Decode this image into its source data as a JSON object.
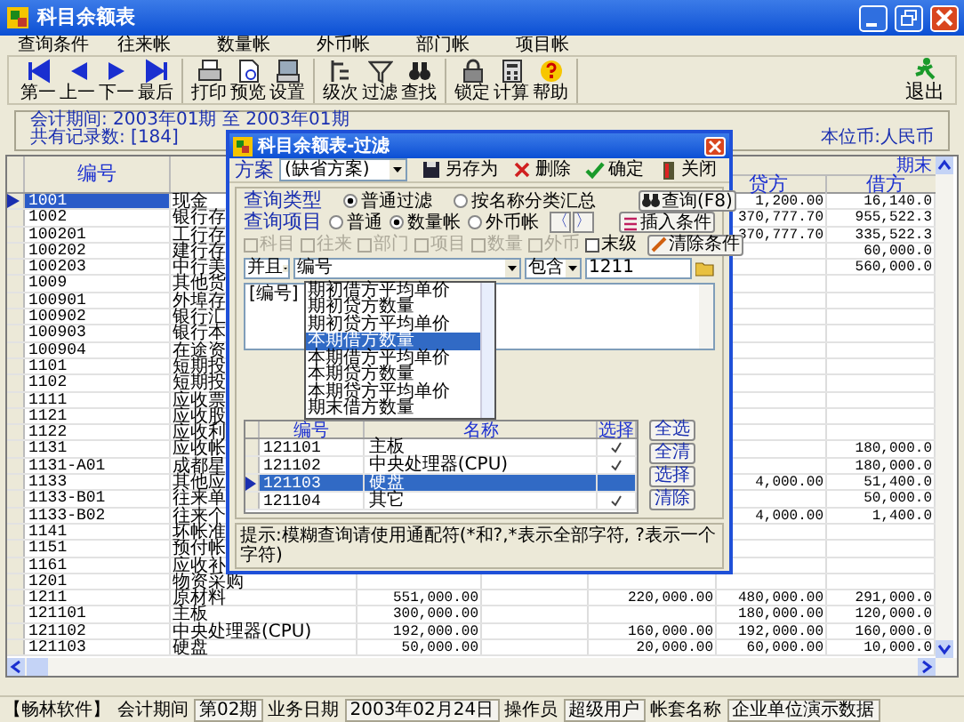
{
  "window": {
    "title": "科目余额表"
  },
  "menu": [
    {
      "label": "查询条件"
    },
    {
      "label": "往来帐"
    },
    {
      "label": "数量帐"
    },
    {
      "label": "外币帐"
    },
    {
      "label": "部门帐"
    },
    {
      "label": "项目帐"
    }
  ],
  "toolbar": {
    "groups": [
      [
        "第一",
        "上一",
        "下一",
        "最后"
      ],
      [
        "打印",
        "预览",
        "设置"
      ],
      [
        "级次",
        "过滤",
        "查找"
      ],
      [
        "锁定",
        "计算",
        "帮助"
      ]
    ],
    "exit": "退出"
  },
  "info": {
    "period": "会计期间: 2003年01期 至 2003年01期",
    "count": "共有记录数: [184]",
    "currency": "本位币:人民币"
  },
  "grid": {
    "header": {
      "code": "编号",
      "group": "期末",
      "credit": "贷方",
      "debit": "借方"
    },
    "rows": [
      {
        "code": "1001",
        "name": "现金",
        "credit": "1,200.00",
        "debit": "16,140.0",
        "selected": true
      },
      {
        "code": "1002",
        "name": "银行存",
        "credit": "370,777.70",
        "debit": "955,522.3",
        "selected": false
      },
      {
        "code": "100201",
        "name": "工行存",
        "credit": "370,777.70",
        "debit": "335,522.3",
        "selected": false
      },
      {
        "code": "100202",
        "name": "建行存",
        "debit": "60,000.0",
        "selected": false
      },
      {
        "code": "100203",
        "name": "中行美",
        "debit": "560,000.0",
        "selected": false
      },
      {
        "code": "1009",
        "name": "其他货",
        "selected": false
      },
      {
        "code": "100901",
        "name": "外埠存",
        "selected": false
      },
      {
        "code": "100902",
        "name": "银行汇",
        "selected": false
      },
      {
        "code": "100903",
        "name": "银行本",
        "selected": false
      },
      {
        "code": "100904",
        "name": "在途资",
        "selected": false
      },
      {
        "code": "1101",
        "name": "短期投",
        "selected": false
      },
      {
        "code": "1102",
        "name": "短期投",
        "selected": false
      },
      {
        "code": "1111",
        "name": "应收票",
        "selected": false
      },
      {
        "code": "1121",
        "name": "应收股",
        "selected": false
      },
      {
        "code": "1122",
        "name": "应收利",
        "selected": false
      },
      {
        "code": "1131",
        "name": "应收帐",
        "debit": "180,000.0",
        "selected": false
      },
      {
        "code": "1131-A01",
        "name": "成都星",
        "debit": "180,000.0",
        "selected": false
      },
      {
        "code": "1133",
        "name": "其他应",
        "credit": "4,000.00",
        "debit": "51,400.0",
        "selected": false
      },
      {
        "code": "1133-B01",
        "name": "往来单",
        "debit": "50,000.0",
        "selected": false
      },
      {
        "code": "1133-B02",
        "name": "往来个",
        "credit": "4,000.00",
        "debit": "1,400.0",
        "selected": false
      },
      {
        "code": "1141",
        "name": "坏帐准",
        "selected": false
      },
      {
        "code": "1151",
        "name": "预付帐",
        "selected": false
      },
      {
        "code": "1161",
        "name": "应收补",
        "selected": false
      },
      {
        "code": "1201",
        "name": "物资采购",
        "selected": false
      },
      {
        "code": "1211",
        "name": "原材料",
        "column_3": "551,000.00",
        "column_5": "220,000.00",
        "credit": "480,000.00",
        "debit": "291,000.0",
        "selected": false
      },
      {
        "code": "121101",
        "name": "主板",
        "column_3": "300,000.00",
        "credit": "180,000.00",
        "debit": "120,000.0",
        "selected": false
      },
      {
        "code": "121102",
        "name": "中央处理器(CPU)",
        "column_3": "192,000.00",
        "column_5": "160,000.00",
        "credit": "192,000.00",
        "debit": "160,000.0",
        "selected": false
      },
      {
        "code": "121103",
        "name": "硬盘",
        "column_3": "50,000.00",
        "column_5": "20,000.00",
        "credit": "60,000.00",
        "debit": "10,000.0",
        "selected": false
      }
    ]
  },
  "dialog": {
    "title": "科目余额表-过滤",
    "scheme_label": "方案",
    "scheme_value": "(缺省方案)",
    "actions": [
      "另存为",
      "删除",
      "确定",
      "关闭"
    ],
    "query_type": {
      "label": "查询类型",
      "options": [
        {
          "label": "普通过滤",
          "selected": true
        },
        {
          "label": "按名称分类汇总",
          "selected": false
        }
      ],
      "button": "查询(F8)"
    },
    "query_item": {
      "label": "查询项目",
      "options": [
        {
          "label": "普通",
          "selected": false
        },
        {
          "label": "数量帐",
          "selected": true
        },
        {
          "label": "外币帐",
          "selected": false
        }
      ],
      "nav": [
        "〈",
        "〉"
      ],
      "insert_button": "插入条件",
      "clear_button": "清除条件"
    },
    "checks": [
      {
        "label": "科目",
        "checked": false,
        "disabled": true
      },
      {
        "label": "往来",
        "checked": false,
        "disabled": true
      },
      {
        "label": "部门",
        "checked": false,
        "disabled": true
      },
      {
        "label": "项目",
        "checked": false,
        "disabled": true
      },
      {
        "label": "数量",
        "checked": false,
        "disabled": true
      },
      {
        "label": "外币",
        "checked": false,
        "disabled": true
      },
      {
        "label": "末级",
        "checked": false,
        "disabled": false
      }
    ],
    "condition": {
      "logic": "并且",
      "field": "编号",
      "operator": "包含",
      "value": "1211"
    },
    "expression": "[编号]",
    "field_list": [
      {
        "label": "期初借方平均单价",
        "selected": false
      },
      {
        "label": "期初贷方数量",
        "selected": false
      },
      {
        "label": "期初贷方平均单价",
        "selected": false
      },
      {
        "label": "本期借方数量",
        "selected": true
      },
      {
        "label": "本期借方平均单价",
        "selected": false
      },
      {
        "label": "本期贷方数量",
        "selected": false
      },
      {
        "label": "本期贷方平均单价",
        "selected": false
      },
      {
        "label": "期末借方数量",
        "selected": false
      }
    ],
    "table": {
      "columns": [
        "编号",
        "名称",
        "选择"
      ],
      "rows": [
        {
          "code": "121101",
          "name": "主板",
          "checked": true,
          "selected": false
        },
        {
          "code": "121102",
          "name": "中央处理器(CPU)",
          "checked": true,
          "selected": false
        },
        {
          "code": "121103",
          "name": "硬盘",
          "checked": false,
          "selected": true
        },
        {
          "code": "121104",
          "name": "其它",
          "checked": true,
          "selected": false
        }
      ]
    },
    "side_buttons": [
      "全选",
      "全清",
      "选择",
      "清除"
    ],
    "hint": "提示:模糊查询请使用通配符(*和?,*表示全部字符, ?表示一个字符)"
  },
  "status_bar": [
    {
      "text": "【畅林软件】",
      "kind": "label"
    },
    {
      "text": "会计期间",
      "kind": "label"
    },
    {
      "text": "第02期",
      "kind": "value"
    },
    {
      "text": "业务日期",
      "kind": "label"
    },
    {
      "text": "2003年02月24日",
      "kind": "value"
    },
    {
      "text": "操作员",
      "kind": "label"
    },
    {
      "text": "超级用户",
      "kind": "value"
    },
    {
      "text": "帐套名称",
      "kind": "label"
    },
    {
      "text": "企业单位演示数据",
      "kind": "value"
    }
  ]
}
